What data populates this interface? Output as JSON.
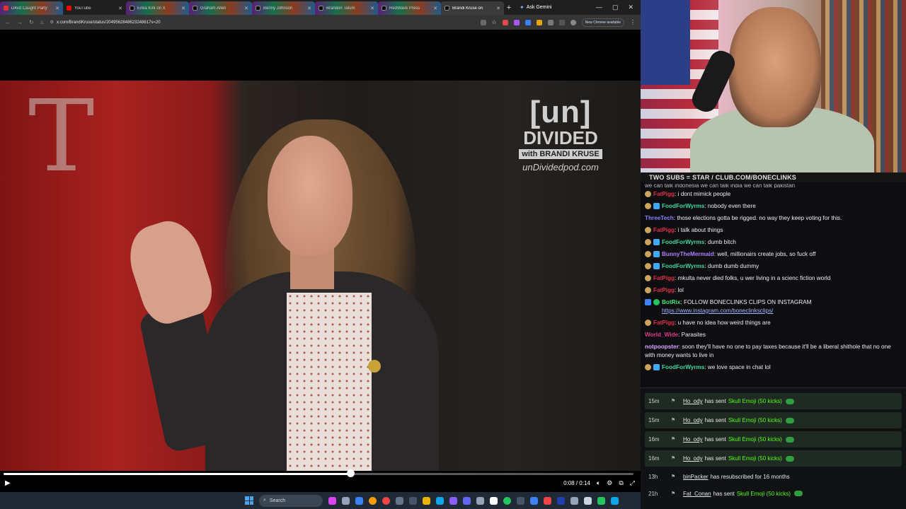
{
  "browser": {
    "tabs": [
      {
        "label": "D4vd Caught Party",
        "icon": "red-circle-icon",
        "active": false
      },
      {
        "label": "YouTube",
        "icon": "youtube-icon",
        "active": false
      },
      {
        "label": "Erika Kirk on X",
        "icon": "x-icon",
        "active": false
      },
      {
        "label": "Graham Allen",
        "icon": "x-icon",
        "active": false
      },
      {
        "label": "Benny Johnson",
        "icon": "x-icon",
        "active": false
      },
      {
        "label": "Brandon Tatum",
        "icon": "x-icon",
        "active": false
      },
      {
        "label": "RedWave Press",
        "icon": "x-icon",
        "active": false
      },
      {
        "label": "Brandi Kruse on",
        "icon": "x-icon",
        "active": true
      }
    ],
    "new_tab": "+",
    "ask_gemini": "Ask Gemini",
    "url": "x.com/BrandiKruse/status/2049562848623248617s=20",
    "new_chrome_available": "New Chrome available"
  },
  "video": {
    "brand_un": "[un]",
    "brand_divided": "DIVIDED",
    "brand_with": "with BRANDI KRUSE",
    "brand_site": "unDividedpod.com",
    "time_display": "0:08 / 0:14",
    "progress_fraction": 0.55
  },
  "taskbar": {
    "search_label": "Search"
  },
  "stream": {
    "banner": "TWO SUBS = STAR / CLUB.COM/BONECLINKS"
  },
  "chat": {
    "cutoff_text": "we can talk indonesia we can talk india we can talk pakistan",
    "messages": [
      {
        "user": "FatPigg",
        "color": "#e0304a",
        "badges": [
          "sub"
        ],
        "text": "i dont mimick people"
      },
      {
        "user": "FoodForWyrms",
        "color": "#3fd6a8",
        "badges": [
          "sub",
          "gift"
        ],
        "text": "nobody even there"
      },
      {
        "user": "ThreeTech",
        "color": "#8a7dff",
        "badges": [],
        "text": "those elections gotta be rigged. no way they keep voting for this."
      },
      {
        "user": "FatPigg",
        "color": "#e0304a",
        "badges": [
          "sub"
        ],
        "text": "i talk about things"
      },
      {
        "user": "FoodForWyrms",
        "color": "#3fd6a8",
        "badges": [
          "sub",
          "gift"
        ],
        "text": "dumb bitch"
      },
      {
        "user": "BunnyTheMermaid",
        "color": "#b07cff",
        "badges": [
          "sub",
          "gift"
        ],
        "text": "well, millionairs create jobs, so fuck off"
      },
      {
        "user": "FoodForWyrms",
        "color": "#3fd6a8",
        "badges": [
          "sub",
          "gift"
        ],
        "text": "dumb dumb dummy"
      },
      {
        "user": "FatPigg",
        "color": "#e0304a",
        "badges": [
          "sub"
        ],
        "text": "mkulta never died folks, u wer living in a scienc fiction world"
      },
      {
        "user": "FatPigg",
        "color": "#e0304a",
        "badges": [
          "sub"
        ],
        "text": "lol"
      },
      {
        "user": "BotRix",
        "color": "#4fe07a",
        "badges": [
          "bot",
          "mod"
        ],
        "text": "FOLLOW BONECLINKS CLIPS ON INSTAGRAM",
        "link": "https://www.instagram.com/boneclinksclips/"
      },
      {
        "user": "FatPigg",
        "color": "#e0304a",
        "badges": [
          "sub"
        ],
        "text": "u have no idea how weird things are"
      },
      {
        "user": "World_Wide",
        "color": "#d93a8a",
        "badges": [],
        "text": "Parasites"
      },
      {
        "user": "notpoopster",
        "color": "#d6a2ff",
        "badges": [],
        "text": "soon they'll have no one to pay taxes because it'll be a liberal shithole that no one with money wants to live in"
      },
      {
        "user": "FoodForWyrms",
        "color": "#3fd6a8",
        "badges": [
          "sub",
          "gift"
        ],
        "text": "we love space in chat lol"
      }
    ]
  },
  "events": [
    {
      "ago": "15m",
      "user": "Ho_ody",
      "action": "has sent",
      "gift": "Skull Emoji (50 kicks)",
      "highlight": true
    },
    {
      "ago": "15m",
      "user": "Ho_ody",
      "action": "has sent",
      "gift": "Skull Emoji (50 kicks)",
      "highlight": true
    },
    {
      "ago": "16m",
      "user": "Ho_ody",
      "action": "has sent",
      "gift": "Skull Emoji (50 kicks)",
      "highlight": true
    },
    {
      "ago": "16m",
      "user": "Ho_ody",
      "action": "has sent",
      "gift": "Skull Emoji (50 kicks)",
      "highlight": true
    },
    {
      "ago": "13h",
      "user": "binPacker",
      "action": "has resubscribed for 16 months",
      "gift": "",
      "highlight": false
    },
    {
      "ago": "21h",
      "user": "Fat_Conan",
      "action": "has sent",
      "gift": "Skull Emoji (50 kicks)",
      "highlight": false
    }
  ]
}
